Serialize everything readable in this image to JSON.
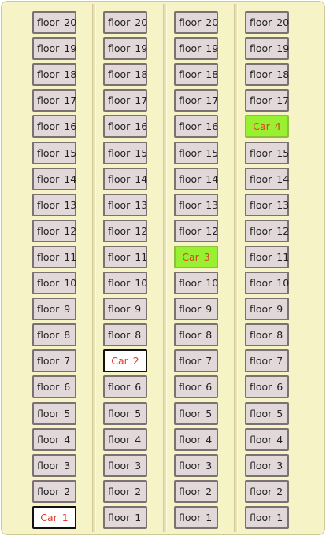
{
  "floor_prefix": "floor",
  "columns": [
    {
      "floors": [
        "20",
        "19",
        "18",
        "17",
        "16",
        "15",
        "14",
        "13",
        "12",
        "11",
        "10",
        "9",
        "8",
        "7",
        "6",
        "5",
        "4",
        "3",
        "2"
      ],
      "car": {
        "label": "Car 1",
        "floor": 1,
        "state": "idle"
      }
    },
    {
      "floors": [
        "20",
        "19",
        "18",
        "17",
        "16",
        "15",
        "14",
        "13",
        "12",
        "11",
        "10",
        "9",
        "8",
        "6",
        "5",
        "4",
        "3",
        "2",
        "1"
      ],
      "car": {
        "label": "Car 2",
        "floor": 7,
        "state": "idle"
      }
    },
    {
      "floors": [
        "20",
        "19",
        "18",
        "17",
        "16",
        "15",
        "14",
        "13",
        "12",
        "10",
        "9",
        "8",
        "7",
        "6",
        "5",
        "4",
        "3",
        "2",
        "1"
      ],
      "car": {
        "label": "Car 3",
        "floor": 11,
        "state": "moving"
      }
    },
    {
      "floors": [
        "20",
        "19",
        "18",
        "17",
        "15",
        "14",
        "13",
        "12",
        "11",
        "10",
        "9",
        "8",
        "7",
        "6",
        "5",
        "4",
        "3",
        "2",
        "1"
      ],
      "car": {
        "label": "Car 4",
        "floor": 16,
        "state": "moving"
      }
    }
  ]
}
